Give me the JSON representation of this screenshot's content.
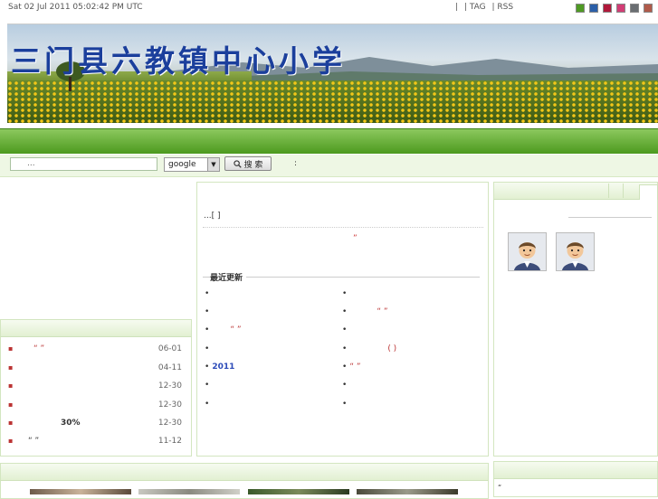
{
  "topbar": {
    "datetime": "Sat 02 Jul 2011 05:02:42 PM UTC",
    "links": [
      "|",
      "| TAG",
      "| RSS"
    ],
    "theme_colors": [
      "#4f9a24",
      "#2b5fa8",
      "#b0183a",
      "#d23d75",
      "#6a6e72",
      "#b05a4a"
    ]
  },
  "banner": {
    "title": "三门县六教镇中心小学"
  },
  "search": {
    "placeholder": "...",
    "engine": "google",
    "button_label": "搜 索",
    "colon": ":"
  },
  "left_list": {
    "items": [
      {
        "title": "“ ”",
        "date": "06-01"
      },
      {
        "title": "",
        "date": "04-11"
      },
      {
        "title": "",
        "date": "12-30"
      },
      {
        "title": "",
        "date": "12-30"
      },
      {
        "title": "30%",
        "date": "12-30"
      },
      {
        "title": "“ ”",
        "date": "11-12"
      }
    ]
  },
  "center": {
    "text1": "...[   ]",
    "text2": "”",
    "recent_title": "最近更新",
    "recent_left": [
      {
        "t": "",
        "cls": "t"
      },
      {
        "t": "",
        "cls": "t"
      },
      {
        "t": "“  ”",
        "cls": "t"
      },
      {
        "t": "",
        "cls": "t"
      },
      {
        "t": "2011",
        "cls": "blue"
      },
      {
        "t": "",
        "cls": "t"
      },
      {
        "t": "",
        "cls": "t"
      }
    ],
    "recent_right": [
      {
        "t": "",
        "cls": "t"
      },
      {
        "t": "“ ”",
        "cls": "t"
      },
      {
        "t": "",
        "cls": "t"
      },
      {
        "t": "( )",
        "cls": "t"
      },
      {
        "t": "“   ”",
        "cls": "t"
      },
      {
        "t": "",
        "cls": "t"
      },
      {
        "t": "",
        "cls": "t"
      }
    ]
  },
  "right_panel": {
    "avatars": [
      "user-avatar",
      "user-avatar"
    ]
  },
  "right_bottom": {
    "mark": "“"
  },
  "colors": {
    "nav_green": "#4c9a1e",
    "panel_border": "#d3e6c0",
    "accent_red": "#b33",
    "link_blue": "#2b4ab8"
  }
}
